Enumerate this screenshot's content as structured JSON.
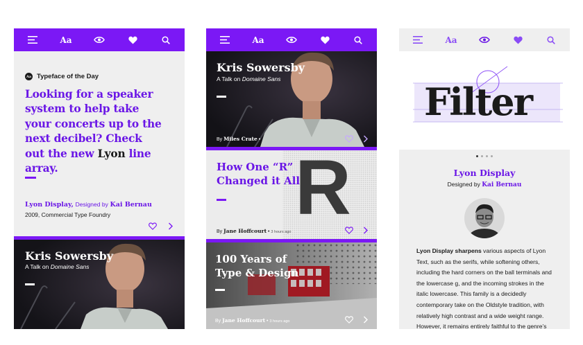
{
  "nav": {
    "menu_icon": "menu-icon",
    "type_label": "Aa",
    "eye_icon": "eye-icon",
    "heart_icon": "heart-icon",
    "search_icon": "search-icon"
  },
  "colors": {
    "accent": "#7b18f5",
    "accent_text": "#6a16e6",
    "dark": "#1a1a1a",
    "panel": "#efefef"
  },
  "screen1": {
    "badge": "Aa",
    "eyebrow": "Typeface of the Day",
    "headline_pre": "Looking for a speaker system to help take your concerts up to the next decibel? Check out the new ",
    "headline_word": "Lyon",
    "headline_post": " line array.",
    "font_name": "Lyon Display,",
    "designed_by": "Designed by",
    "designer": "Kai Bernau",
    "meta": "2009, Commercial Type Foundry",
    "talk_title": "Kris Sowersby",
    "talk_sub_pre": "A Talk on ",
    "talk_sub_font": "Domaine Sans"
  },
  "screen2": {
    "feature": {
      "title": "Kris Sowersby",
      "sub_pre": "A Talk on ",
      "sub_font": "Domaine Sans",
      "by": "By",
      "author": "Miles Crate",
      "dot": "•"
    },
    "article1": {
      "title_line1": "How One “R”",
      "title_line2": "Changed it All",
      "big_letter": "R",
      "by": "By",
      "author": "Jane Hoffcourt",
      "dot": "•",
      "time": "3 hours ago"
    },
    "article2": {
      "title_line1": "100 Years of",
      "title_line2": "Type & Design",
      "by": "By",
      "author": "Jane Hoffcourt",
      "dot": "•",
      "time": "3 hours ago"
    }
  },
  "screen3": {
    "hero_word": "Filter",
    "font_name": "Lyon Display",
    "designed_by": "Designed by",
    "designer": "Kai Bernau",
    "body_lead": "Lyon Display sharpens",
    "body_rest": " various aspects of Lyon Text, such as the serifs, while softening others, including the hard corners on the ball terminals and the lowercase g, and the incoming strokes in the italic lowercase. This family is a decidedly contemporary take on the Oldstyle tradition, with relatively high contrast and a wide weight range. However, it remains entirely faithful to the genre’s"
  }
}
